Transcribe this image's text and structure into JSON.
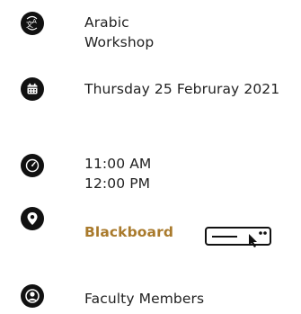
{
  "session": {
    "title_line1": "Arabic",
    "title_line2": "Workshop",
    "date": "Thursday 25 Februray 2021",
    "time_start": "11:00 AM",
    "time_end": "12:00 PM",
    "location_link": "Blackboard",
    "faculty_label": "Faculty Members"
  },
  "icons": {
    "language": "translate-icon",
    "date": "calendar-icon",
    "time": "clock-icon",
    "location": "location-pin-icon",
    "platform": "keyboard-icon",
    "faculty": "person-icon"
  },
  "colors": {
    "icon_bg": "#111111",
    "link": "#a97a2c",
    "text": "#222222"
  }
}
